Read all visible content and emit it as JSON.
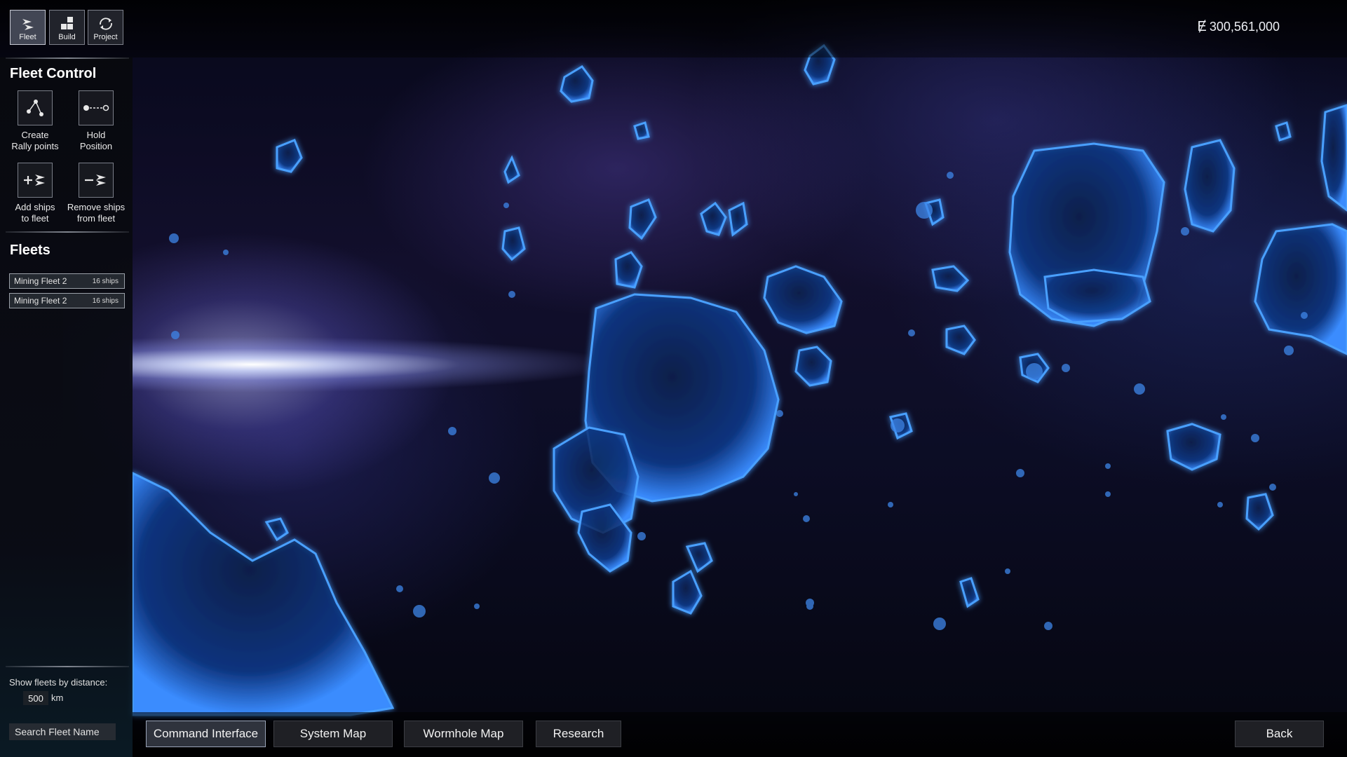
{
  "top_bar": {
    "modes": [
      {
        "label": "Fleet",
        "icon": "fleet-icon"
      },
      {
        "label": "Build",
        "icon": "build-grid-icon"
      },
      {
        "label": "Project",
        "icon": "project-cycle-icon"
      }
    ],
    "currency_symbol": "Ɇ",
    "credits": "300,561,000"
  },
  "left_panel": {
    "fleet_control_title": "Fleet Control",
    "tools": [
      {
        "line1": "Create",
        "line2": "Rally points",
        "icon": "rally-points-icon"
      },
      {
        "line1": "Hold",
        "line2": "Position",
        "icon": "hold-position-icon"
      },
      {
        "line1": "Add ships",
        "line2": "to fleet",
        "icon": "add-ships-icon"
      },
      {
        "line1": "Remove ships",
        "line2": "from fleet",
        "icon": "remove-ships-icon"
      }
    ],
    "fleets_title": "Fleets",
    "fleets": [
      {
        "name": "Mining Fleet 2",
        "ships": "16 ships"
      },
      {
        "name": "Mining Fleet 2",
        "ships": "16 ships"
      }
    ],
    "distance_label": "Show fleets by distance:",
    "distance_value": "500",
    "distance_unit": "km",
    "search_placeholder": "Search Fleet Name"
  },
  "bottom_bar": {
    "tabs": [
      {
        "label": "Command Interface",
        "active": true
      },
      {
        "label": "System Map",
        "active": false
      },
      {
        "label": "Wormhole Map",
        "active": false
      },
      {
        "label": "Research",
        "active": false
      }
    ],
    "back_label": "Back"
  },
  "colors": {
    "asteroid_glow": "#3a8cff",
    "asteroid_fill": "#0b2a66",
    "panel_bg": "#08090e",
    "button_border": "#7d808a"
  }
}
